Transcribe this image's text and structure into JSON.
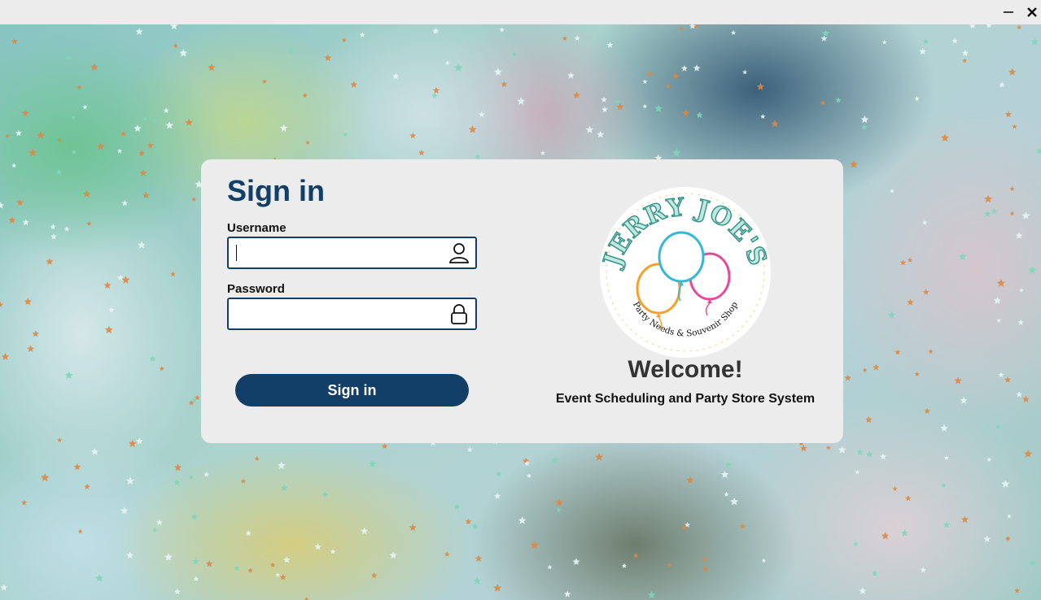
{
  "window": {
    "minimize_glyph": "—",
    "close_glyph": "✕"
  },
  "signin": {
    "title": "Sign in",
    "username_label": "Username",
    "username_value": "",
    "password_label": "Password",
    "password_value": "",
    "button_label": "Sign in",
    "username_icon": "user-icon",
    "password_icon": "lock-icon"
  },
  "brand": {
    "logo_name": "JERRY JOE'S",
    "logo_tagline": "Party Needs & Souvenir Shop",
    "welcome": "Welcome!",
    "subtitle": "Event Scheduling and Party Store System"
  },
  "colors": {
    "primary": "#123f67",
    "logo_teal": "#2aa69a",
    "balloon_blue": "#33b9d6",
    "balloon_pink": "#e64b9b",
    "balloon_orange": "#f2a22c"
  }
}
